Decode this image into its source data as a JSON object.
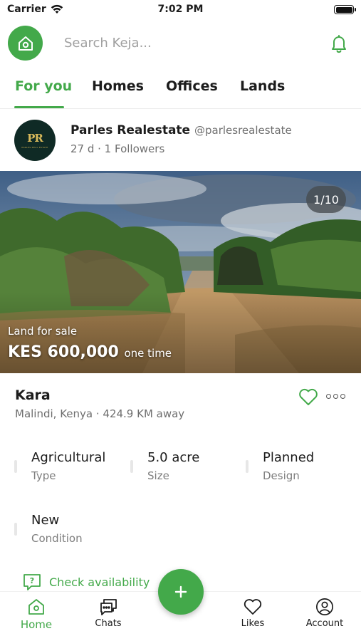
{
  "status_bar": {
    "carrier": "Carrier",
    "time": "7:02 PM"
  },
  "search": {
    "placeholder": "Search Keja..."
  },
  "tabs": [
    {
      "label": "For you",
      "active": true
    },
    {
      "label": "Homes",
      "active": false
    },
    {
      "label": "Offices",
      "active": false
    },
    {
      "label": "Lands",
      "active": false
    }
  ],
  "poster": {
    "name": "Parles Realestate",
    "handle": "@parlesrealestate",
    "meta": "27 d · 1 Followers",
    "avatar_text": "PR",
    "avatar_subtext": "PARLES REAL ESTATE"
  },
  "hero": {
    "counter": "1/10",
    "subtitle": "Land for sale",
    "price": "KES 600,000",
    "price_frequency": "one time"
  },
  "listing": {
    "title": "Kara",
    "location": "Malindi, Kenya · 424.9 KM away"
  },
  "specs": [
    {
      "value": "Agricultural",
      "label": "Type"
    },
    {
      "value": "5.0 acre",
      "label": "Size"
    },
    {
      "value": "Planned",
      "label": "Design"
    },
    {
      "value": "New",
      "label": "Condition"
    }
  ],
  "cta": {
    "check_availability": "Check availability"
  },
  "bottom_nav": {
    "home": "Home",
    "chats": "Chats",
    "likes": "Likes",
    "account": "Account"
  },
  "colors": {
    "accent": "#43a94a",
    "text": "#1c1c1c",
    "muted": "#6f6f6f"
  }
}
